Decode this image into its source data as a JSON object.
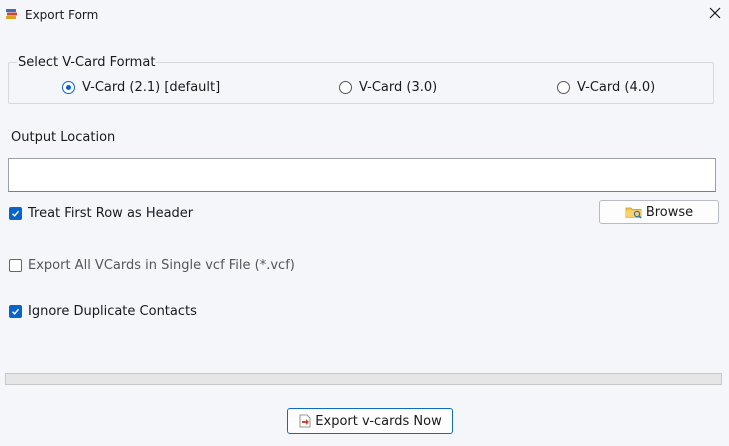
{
  "window": {
    "title": "Export Form",
    "app_icon": "books-icon",
    "close_icon": "close-icon"
  },
  "vcard_format": {
    "legend": "Select V-Card Format",
    "options": [
      {
        "label": "V-Card (2.1) [default]",
        "selected": true
      },
      {
        "label": "V-Card (3.0)",
        "selected": false
      },
      {
        "label": "V-Card (4.0)",
        "selected": false
      }
    ]
  },
  "output": {
    "label": "Output Location",
    "value": "",
    "placeholder": ""
  },
  "options": {
    "first_row_header": {
      "label": "Treat First Row as Header",
      "checked": true
    },
    "single_vcf": {
      "label": "Export All VCards in Single vcf File (*.vcf)",
      "checked": false
    },
    "ignore_duplicates": {
      "label": "Ignore Duplicate Contacts",
      "checked": true
    }
  },
  "browse": {
    "label": "Browse",
    "icon": "folder-icon"
  },
  "progress": {
    "value": 0
  },
  "export": {
    "label": "Export v-cards Now",
    "icon": "export-file-icon"
  },
  "colors": {
    "accent": "#0a63c9",
    "window_bg": "#f4f6fa",
    "groupbox_border": "#d6d9de"
  }
}
